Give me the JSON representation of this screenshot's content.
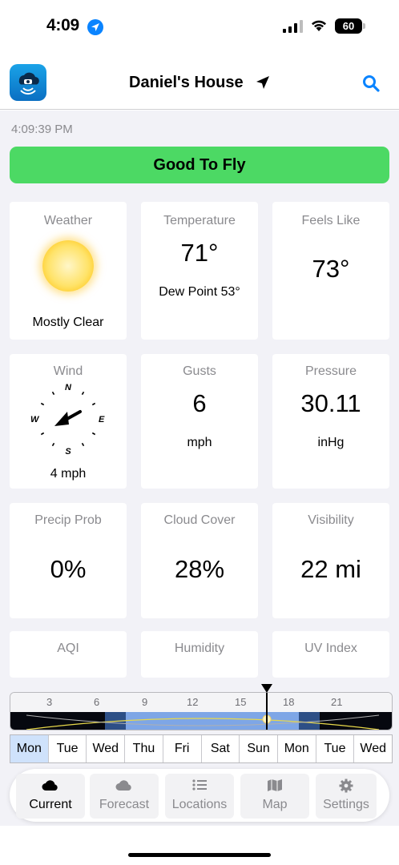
{
  "status_bar": {
    "time": "4:09",
    "battery": "60"
  },
  "header": {
    "title": "Daniel's House"
  },
  "content": {
    "timestamp": "4:09:39 PM",
    "fly_status": "Good To Fly",
    "cards": {
      "weather": {
        "title": "Weather",
        "condition": "Mostly Clear"
      },
      "temperature": {
        "title": "Temperature",
        "value": "71°",
        "dew_point": "Dew Point 53°"
      },
      "feels_like": {
        "title": "Feels Like",
        "value": "73°"
      },
      "wind": {
        "title": "Wind",
        "speed": "4 mph",
        "compass": {
          "n": "N",
          "e": "E",
          "s": "S",
          "w": "W"
        }
      },
      "gusts": {
        "title": "Gusts",
        "value": "6",
        "unit": "mph"
      },
      "pressure": {
        "title": "Pressure",
        "value": "30.11",
        "unit": "inHg"
      },
      "precip": {
        "title": "Precip Prob",
        "value": "0%"
      },
      "cloud": {
        "title": "Cloud Cover",
        "value": "28%"
      },
      "visibility": {
        "title": "Visibility",
        "value": "22 mi"
      },
      "aqi": {
        "title": "AQI"
      },
      "humidity": {
        "title": "Humidity"
      },
      "uv": {
        "title": "UV Index"
      }
    },
    "timeline": {
      "hours": [
        "3",
        "6",
        "9",
        "12",
        "15",
        "18",
        "21"
      ]
    },
    "days": [
      "Mon",
      "Tue",
      "Wed",
      "Thu",
      "Fri",
      "Sat",
      "Sun",
      "Mon",
      "Tue",
      "Wed"
    ],
    "selected_day_index": 0
  },
  "tabbar": {
    "current": "Current",
    "forecast": "Forecast",
    "locations": "Locations",
    "map": "Map",
    "settings": "Settings"
  },
  "colors": {
    "fly_good": "#4cd964",
    "accent": "#0a84ff",
    "selected_day": "#cfe2fb"
  }
}
